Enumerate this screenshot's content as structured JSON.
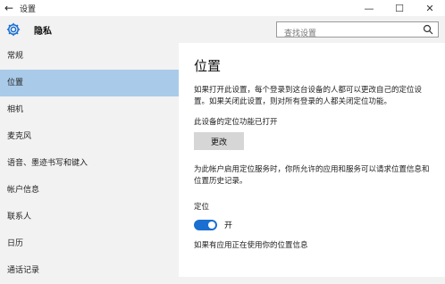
{
  "window": {
    "title": "设置",
    "controls": {
      "minimize": "—",
      "maximize": "☐",
      "close": "✕"
    }
  },
  "header": {
    "title": "隐私",
    "search_placeholder": "查找设置"
  },
  "sidebar": {
    "items": [
      {
        "label": "常规"
      },
      {
        "label": "位置"
      },
      {
        "label": "相机"
      },
      {
        "label": "麦克风"
      },
      {
        "label": "语音、墨迹书写和键入"
      },
      {
        "label": "帐户信息"
      },
      {
        "label": "联系人"
      },
      {
        "label": "日历"
      },
      {
        "label": "通话记录"
      }
    ],
    "active_index": 1
  },
  "main": {
    "title": "位置",
    "intro": "如果打开此设置，每个登录到这台设备的人都可以更改自己的定位设置。如果关闭此设置，则对所有登录的人都关闭定位功能。",
    "status": "此设备的定位功能已打开",
    "change_button": "更改",
    "service_desc": "为此帐户启用定位服务时，你所允许的应用和服务可以请求位置信息和位置历史记录。",
    "location_label": "定位",
    "toggle_state": "开",
    "toggle_on": true,
    "apps_note": "如果有应用正在使用你的位置信息"
  },
  "colors": {
    "accent": "#1a6fd1",
    "sidebar_active": "#a9cbe9"
  }
}
